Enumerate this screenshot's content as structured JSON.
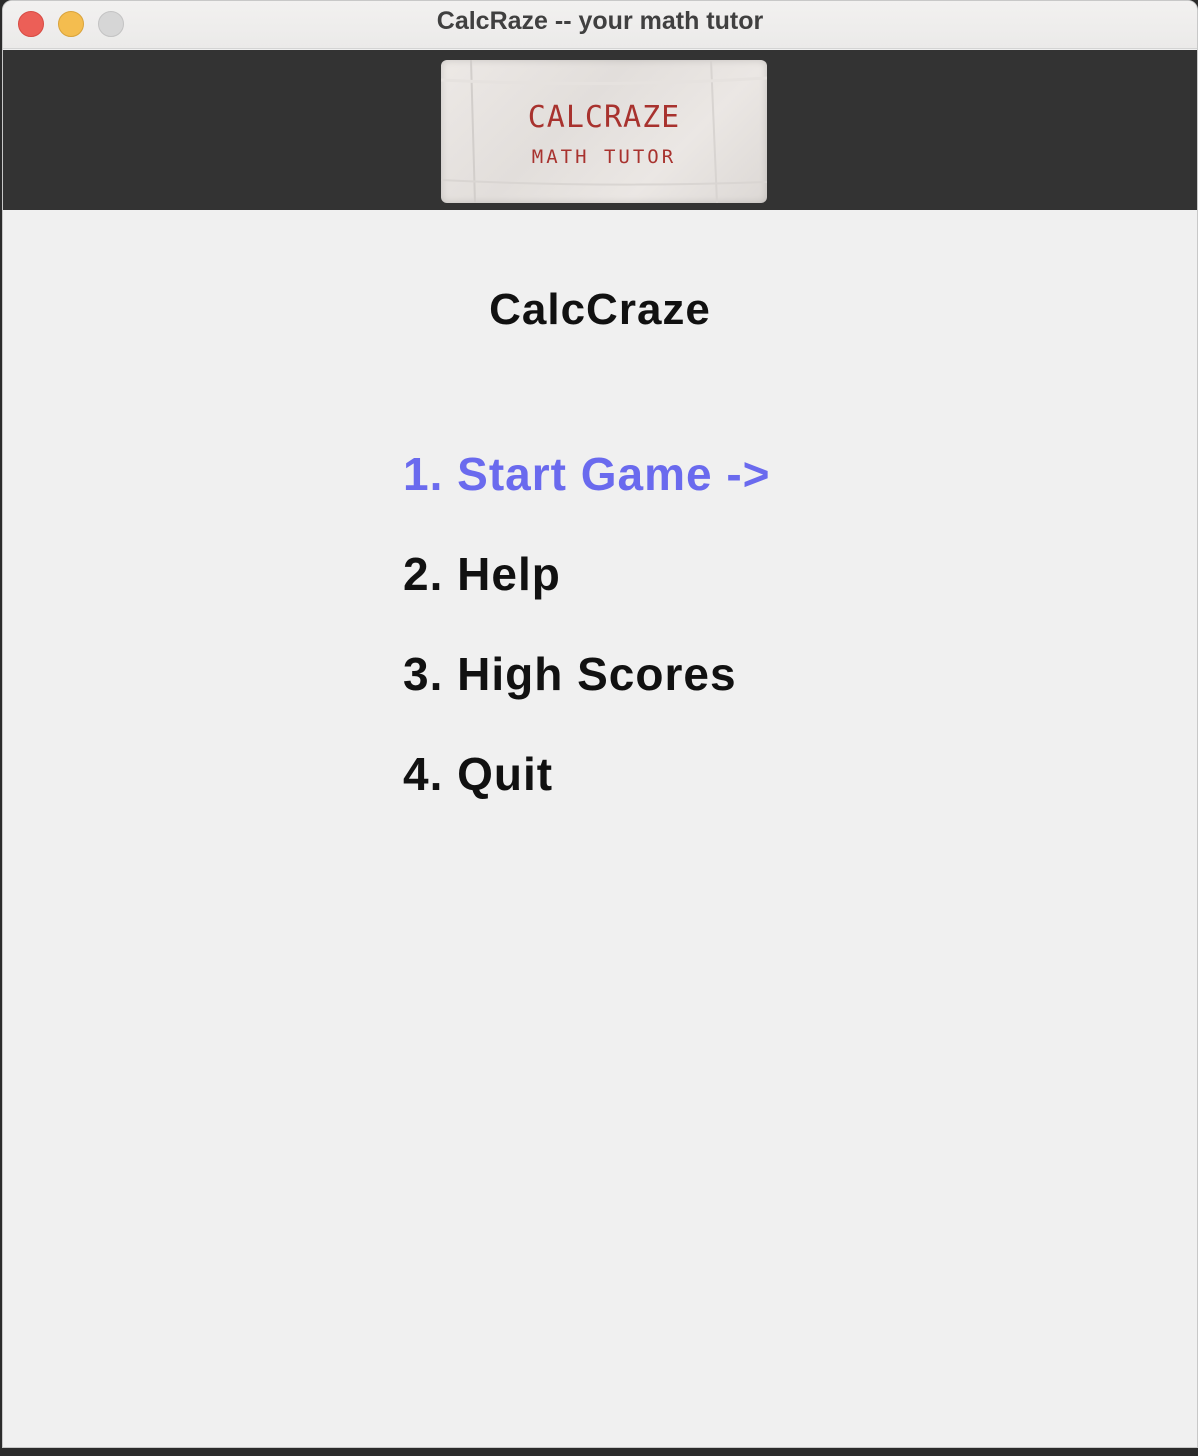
{
  "window": {
    "title": "CalcRaze -- your math tutor"
  },
  "logo": {
    "line1": "CALCRAZE",
    "line2": "MATH TUTOR",
    "text_color": "#a8322e"
  },
  "main": {
    "title": "CalcCraze",
    "menu": [
      {
        "label": "1. Start Game ->",
        "selected": true
      },
      {
        "label": "2. Help",
        "selected": false
      },
      {
        "label": "3. High Scores",
        "selected": false
      },
      {
        "label": "4. Quit",
        "selected": false
      }
    ],
    "selected_color": "#6a6aee",
    "text_color": "#111111"
  },
  "icons": {
    "close": "close-traffic-light-icon",
    "minimize": "minimize-traffic-light-icon",
    "maximize": "maximize-traffic-light-icon"
  }
}
